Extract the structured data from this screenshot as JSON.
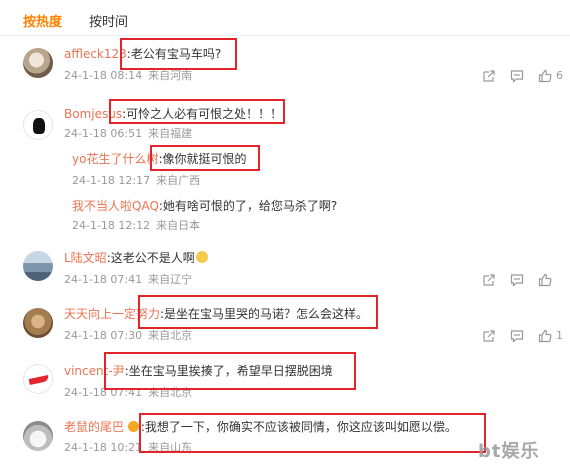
{
  "tabs": {
    "hot": "按热度",
    "time": "按时间"
  },
  "comments": [
    {
      "user": "affleck123",
      "text": ":老公有宝马车吗?",
      "date": "24-1-18 08:14",
      "loc": "来自河南",
      "likes": "6",
      "avatar": "cat-avatar"
    },
    {
      "user": "Bomjesus",
      "text": ":可怜之人必有可恨之处！！！",
      "date": "24-1-18 06:51",
      "loc": "来自福建",
      "likes": "",
      "avatar": "black-cat-avatar"
    }
  ],
  "replies": [
    {
      "user": "yo花生了什么树",
      "text": ":像你就挺可恨的",
      "date": "24-1-18 12:17",
      "loc": "来自广西"
    },
    {
      "user": "我不当人啦QAQ",
      "text": ":她有啥可恨的了，给您马杀了啊?",
      "date": "24-1-18 12:12",
      "loc": "来自日本"
    }
  ],
  "comments2": [
    {
      "user": "L陆文昭",
      "text": ":这老公不是人啊",
      "date": "24-1-18 07:41",
      "loc": "来自辽宁",
      "likes": "",
      "avatar": "sea-avatar"
    },
    {
      "user": "天天向上一定努力",
      "text": ":是坐在宝马里哭的马诺？怎么会这样。",
      "date": "24-1-18 07:30",
      "loc": "来自北京",
      "likes": "1",
      "avatar": "dog-avatar"
    },
    {
      "user": "vincent-尹",
      "text": ":坐在宝马里挨揍了，希望早日摆脱困境",
      "date": "24-1-18 07:41",
      "loc": "来自北京",
      "likes": "",
      "avatar": "nike-avatar"
    },
    {
      "user": "老鼠的尾巴",
      "text": ":我想了一下，你确实不应该被同情，你这应该叫如愿以偿。",
      "date": "24-1-18 10:21",
      "loc": "来自山东",
      "likes": "",
      "avatar": "rat-avatar"
    }
  ],
  "watermark": "bt娱乐",
  "colors": {
    "accent": "#ff8200",
    "username": "#eb7350",
    "highlight_box": "#e2242b"
  }
}
